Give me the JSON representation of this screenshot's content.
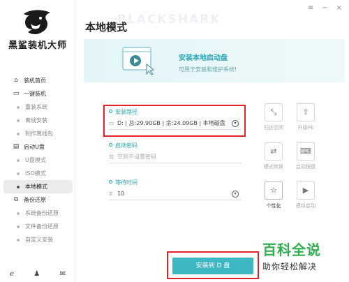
{
  "app": {
    "brand": "黑鲨装机大师",
    "window_controls": [
      "≡",
      "−",
      "×"
    ]
  },
  "sidebar": {
    "items": [
      {
        "label": "装机首页",
        "icon": "home-icon",
        "glyph": "⌂",
        "type": "main"
      },
      {
        "label": "一键装机",
        "icon": "monitor-icon",
        "glyph": "▭",
        "type": "main"
      },
      {
        "label": "重装系统",
        "type": "sub"
      },
      {
        "label": "离线安装",
        "type": "sub"
      },
      {
        "label": "制作离线包",
        "type": "sub"
      },
      {
        "label": "启动U盘",
        "icon": "usb-icon",
        "glyph": "▤",
        "type": "main"
      },
      {
        "label": "U盘模式",
        "type": "sub"
      },
      {
        "label": "ISO模式",
        "type": "sub"
      },
      {
        "label": "本地模式",
        "type": "sub",
        "active": true
      },
      {
        "label": "备份还原",
        "icon": "backup-icon",
        "glyph": "⧉",
        "type": "main"
      },
      {
        "label": "系统备份还原",
        "type": "sub"
      },
      {
        "label": "文件备份还原",
        "type": "sub"
      },
      {
        "label": "自定义安装",
        "type": "sub"
      }
    ],
    "bottom_icons": [
      "browser-icon",
      "qq-icon",
      "wechat-icon"
    ]
  },
  "main": {
    "title": "本地模式",
    "watermark": "BLACKSHARK",
    "banner": {
      "title": "安装本地启动盘",
      "subtitle": "可用于安装和维护系统!"
    },
    "install_path": {
      "label": "安装路径",
      "value": "D: | 总:29.90GB | 余:24.09GB | 本地磁盘"
    },
    "boot_password": {
      "label": "启动密码",
      "placeholder": "空则不设置密码"
    },
    "wait_time": {
      "label": "等待时间",
      "value": "10"
    },
    "tools": [
      {
        "label": "归还空间",
        "icon": "shrink-icon",
        "glyph": "⤡",
        "active": false
      },
      {
        "label": "升级PE",
        "icon": "upgrade-icon",
        "glyph": "⇧",
        "active": false
      },
      {
        "label": "模式转换",
        "icon": "convert-icon",
        "glyph": "⇄",
        "active": false
      },
      {
        "label": "启动按键",
        "icon": "boot-key-icon",
        "glyph": "⌨",
        "active": false
      },
      {
        "label": "个性化",
        "icon": "personalize-icon",
        "glyph": "☆",
        "active": true
      },
      {
        "label": "模拟启动",
        "icon": "simulate-boot-icon",
        "glyph": "▶",
        "active": false
      }
    ],
    "install_button": "安装到 D 盘"
  },
  "corner_logo": {
    "big": "百科全说",
    "small": "助你轻松解决"
  },
  "colors": {
    "accent": "#3fb7c3",
    "highlight": "#e0242a",
    "corner_green": "#2fae4e"
  }
}
